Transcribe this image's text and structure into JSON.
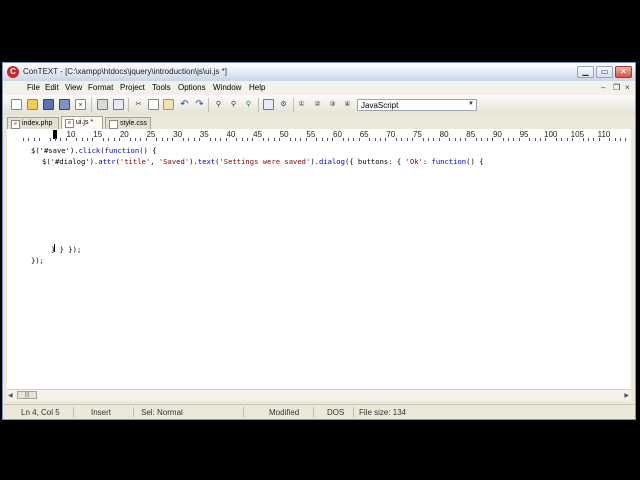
{
  "window": {
    "title": "ConTEXT - [C:\\xampp\\htdocs\\jquery\\introduction\\js\\ui.js *]",
    "app_icon_letter": "C"
  },
  "menu": {
    "items": [
      "File",
      "Edit",
      "View",
      "Format",
      "Project",
      "Tools",
      "Options",
      "Window",
      "Help"
    ]
  },
  "toolbar": {
    "icons": [
      "new-file-icon",
      "open-file-icon",
      "save-icon",
      "save-all-icon",
      "close-file-icon",
      "print-icon",
      "print-preview-icon",
      "cut-icon",
      "copy-icon",
      "paste-icon",
      "undo-icon",
      "redo-icon",
      "find-icon",
      "find-next-icon",
      "replace-icon",
      "export-icon",
      "options-icon",
      "user-command-1-icon",
      "user-command-2-icon",
      "user-command-3-icon",
      "user-command-4-icon"
    ],
    "highlighter": "JavaScript"
  },
  "tabs": [
    {
      "label": "index.php",
      "active": false
    },
    {
      "label": "ui.js *",
      "active": true
    },
    {
      "label": "style.css",
      "active": false
    }
  ],
  "ruler": {
    "labels": [
      "10",
      "15",
      "20",
      "25",
      "30",
      "35",
      "40",
      "45",
      "50",
      "55",
      "60",
      "65",
      "70",
      "75",
      "80",
      "85",
      "90",
      "95",
      "100",
      "105",
      "110"
    ]
  },
  "code": {
    "line1": {
      "a": "$('#save').",
      "b": "click",
      "c": "(",
      "d": "function",
      "e": "() {"
    },
    "line2": {
      "a": "$('#dialog').",
      "b": "attr",
      "c": "(",
      "d": "'title'",
      "e": ", ",
      "f": "'Saved'",
      "g": ").",
      "h": "text",
      "i": "(",
      "j": "'Settings were saved'",
      "k": ").",
      "l": "dialog",
      "m": "({ buttons: { ",
      "n": "'Ok'",
      "o": ": ",
      "p": "function",
      "q": "() {"
    },
    "line4": "} } });",
    "line5": "});"
  },
  "status": {
    "position": "Ln 4, Col 5",
    "mode": "Insert",
    "selection": "Sel: Normal",
    "modified": "Modified",
    "line_ending": "DOS",
    "file_size": "File size: 134"
  },
  "colors": {
    "keyword": "#0000c0",
    "string": "#800000"
  }
}
